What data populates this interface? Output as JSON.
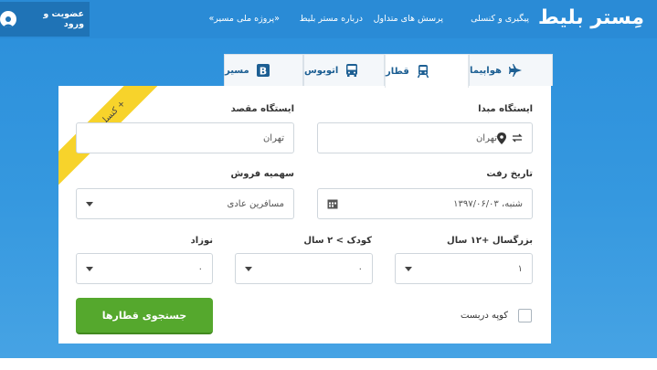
{
  "nav": {
    "logo": "مِستر بلیط",
    "links": [
      "پیگیری و کنسلی",
      "پرسش های متداول",
      "درباره مستر بلیط",
      "«پروژه ملی مسیر»"
    ],
    "login": "عضویت و ورود"
  },
  "tabs": [
    {
      "label": "هواپیما",
      "icon": "plane-icon",
      "active": false
    },
    {
      "label": "قطار",
      "icon": "train-icon",
      "active": true
    },
    {
      "label": "اتوبوس",
      "icon": "bus-icon",
      "active": false
    },
    {
      "label": "مسیر",
      "icon": "b-icon",
      "active": false
    }
  ],
  "ribbon": "+ کنسلی اینترنتی",
  "form": {
    "origin_label": "ایستگاه مبدا",
    "origin_value": "تهران",
    "dest_label": "ایستگاه مقصد",
    "dest_value": "تهران",
    "date_label": "تاریخ رفت",
    "date_value": "شنبه، ۱۳۹۷/۰۶/۰۳",
    "quota_label": "سهمیه فروش",
    "quota_value": "مسافرین عادی",
    "adult_label": "بزرگسال +۱۲ سال",
    "adult_value": "۱",
    "child_label": "کودک > ۲ سال",
    "child_value": "۰",
    "infant_label": "نوزاد",
    "infant_value": "۰",
    "coupe_label": "کوپه دربست",
    "search_label": "جستجوی قطارها"
  },
  "colors": {
    "brand_blue": "#2a8bd6",
    "search_green": "#55a82d",
    "ribbon_yellow": "#f7d32b"
  }
}
